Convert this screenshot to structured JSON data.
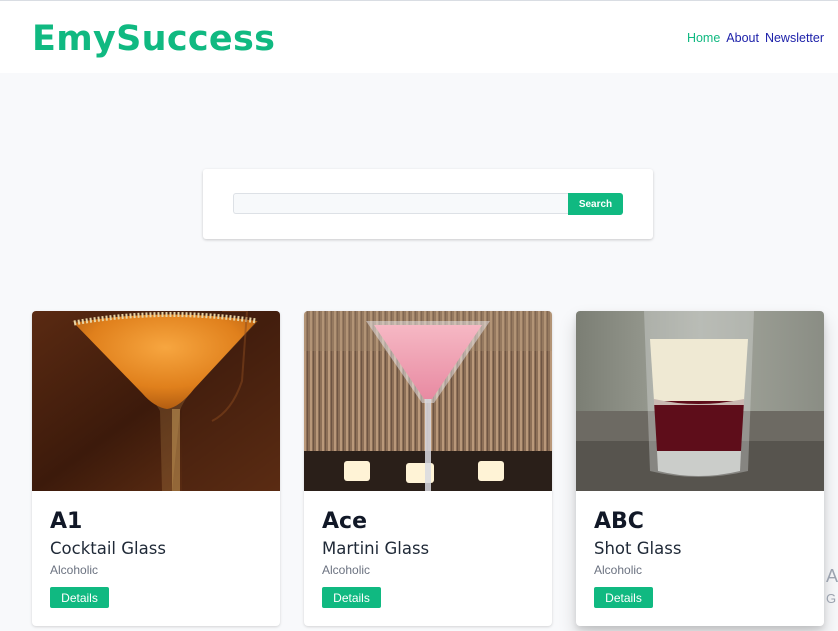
{
  "brand": {
    "name": "EmySuccess",
    "color": "#10b981"
  },
  "nav": {
    "items": [
      {
        "label": "Home",
        "active": true
      },
      {
        "label": "About",
        "active": false
      },
      {
        "label": "Newsletter",
        "active": false
      }
    ]
  },
  "search": {
    "value": "",
    "placeholder": "",
    "button_label": "Search"
  },
  "drinks": [
    {
      "name": "A1",
      "glass": "Cocktail Glass",
      "type": "Alcoholic",
      "button_label": "Details",
      "image_icon": "cocktail-photo"
    },
    {
      "name": "Ace",
      "glass": "Martini Glass",
      "type": "Alcoholic",
      "button_label": "Details",
      "image_icon": "martini-photo"
    },
    {
      "name": "ABC",
      "glass": "Shot Glass",
      "type": "Alcoholic",
      "button_label": "Details",
      "image_icon": "shot-photo"
    }
  ],
  "edge_text": {
    "line1": "A",
    "line2": "G"
  }
}
